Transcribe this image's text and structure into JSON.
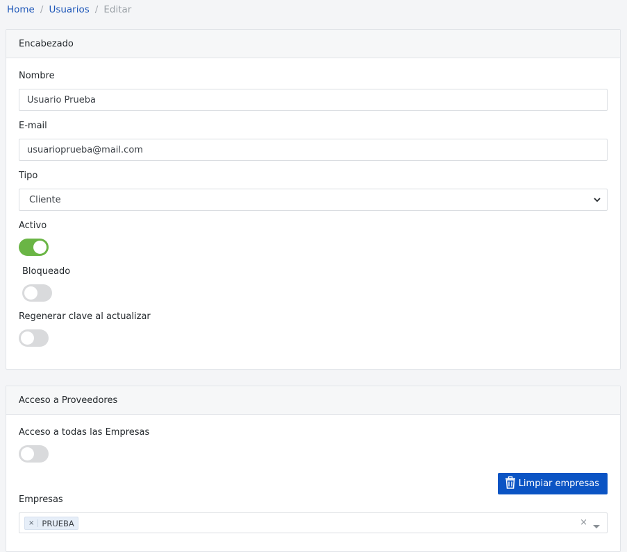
{
  "breadcrumb": {
    "home": "Home",
    "users": "Usuarios",
    "current": "Editar"
  },
  "colors": {
    "link": "#1d56b8",
    "toggle_on": "#6ab545",
    "primary": "#0b54c4"
  },
  "header_card": {
    "title": "Encabezado",
    "nombre_label": "Nombre",
    "nombre_value": "Usuario Prueba",
    "email_label": "E-mail",
    "email_value": "usuarioprueba@mail.com",
    "tipo_label": "Tipo",
    "tipo_value": "Cliente",
    "activo_label": "Activo",
    "activo_on": true,
    "bloqueado_label": "Bloqueado",
    "bloqueado_on": false,
    "regenerar_label": "Regenerar clave al actualizar",
    "regenerar_on": false
  },
  "proveedores_card": {
    "title": "Acceso a Proveedores",
    "todas_label": "Acceso a todas las Empresas",
    "todas_on": false,
    "limpiar_button": "Limpiar empresas",
    "empresas_label": "Empresas",
    "empresas_tags": [
      "PRUEBA"
    ],
    "clear_symbol": "×",
    "tag_remove_symbol": "×"
  },
  "icons": [
    "chevron-down-icon",
    "trash-icon",
    "close-icon",
    "caret-down-icon"
  ]
}
